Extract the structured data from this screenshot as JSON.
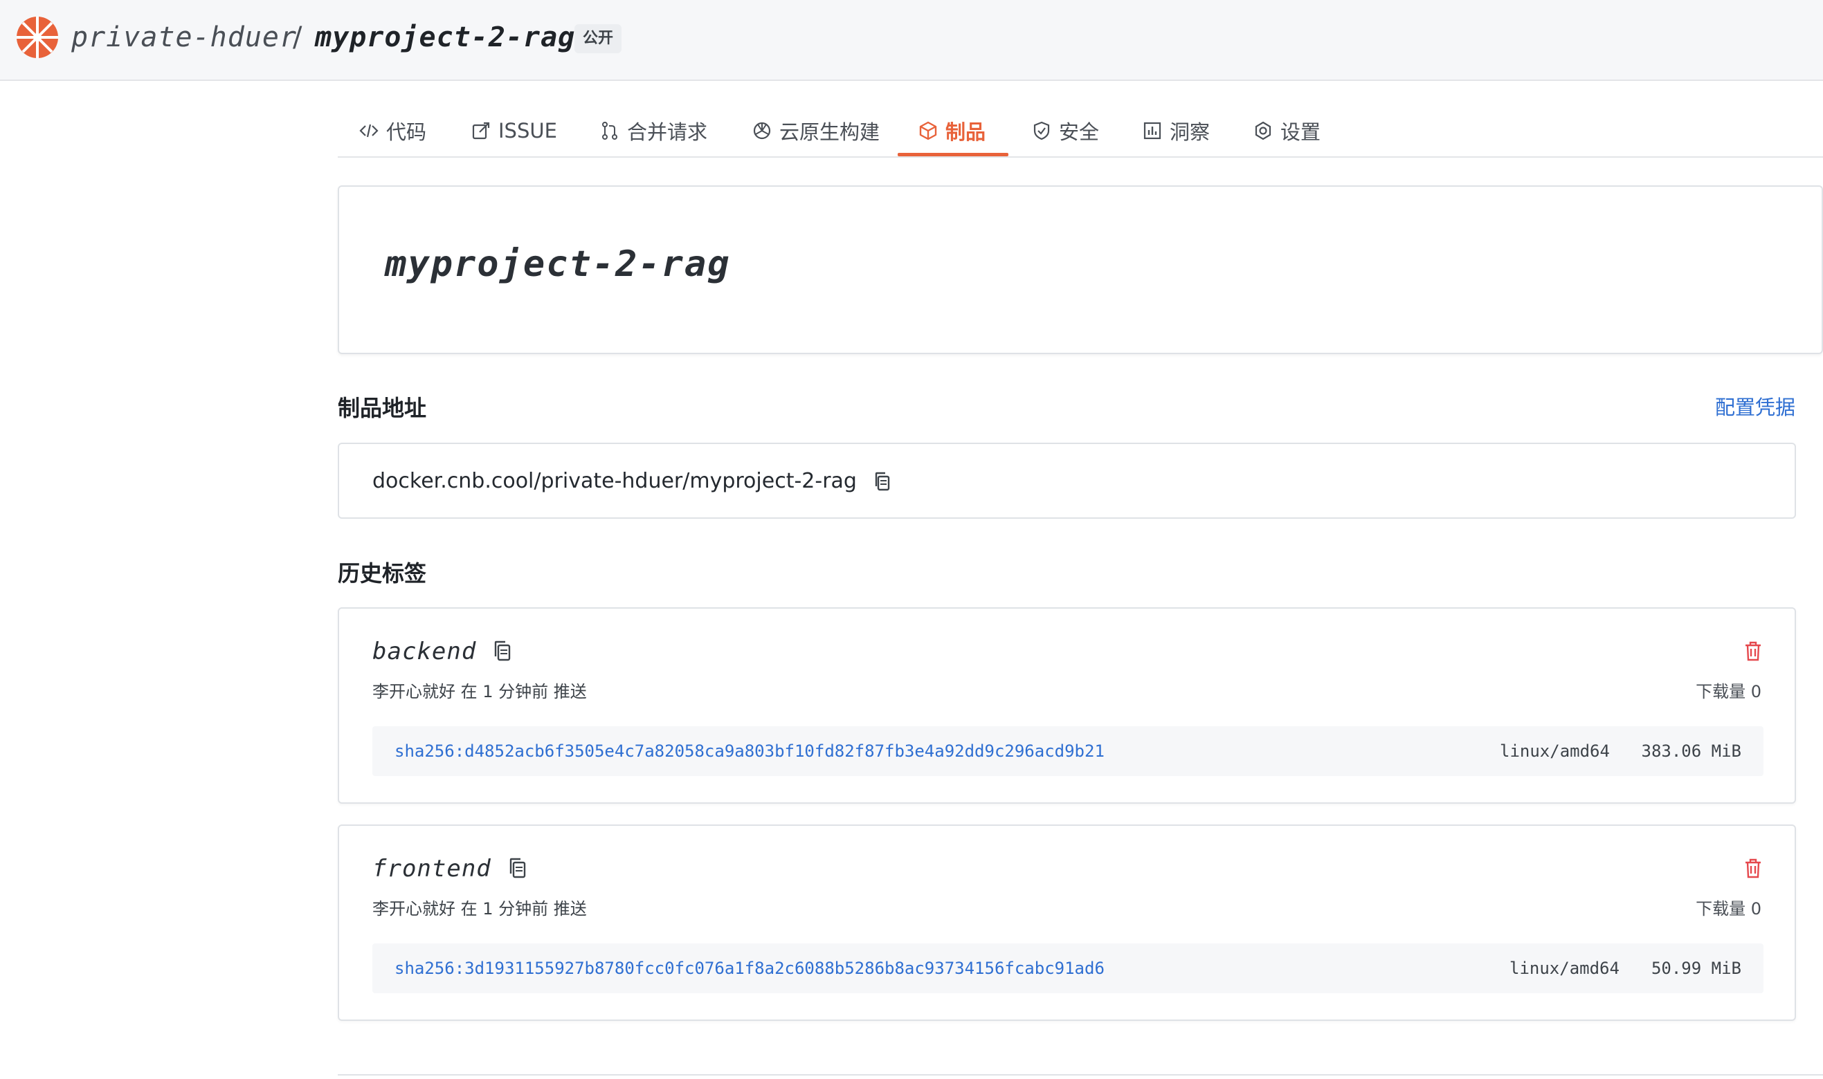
{
  "header": {
    "owner": "private-hduer",
    "separator": "/",
    "repo": "myproject-2-rag",
    "visibility_badge": "公开"
  },
  "tabs": [
    {
      "label": "代码",
      "icon": "code-icon"
    },
    {
      "label": "ISSUE",
      "icon": "issue-icon"
    },
    {
      "label": "合并请求",
      "icon": "merge-request-icon"
    },
    {
      "label": "云原生构建",
      "icon": "build-icon"
    },
    {
      "label": "制品",
      "icon": "package-icon",
      "active": true
    },
    {
      "label": "安全",
      "icon": "shield-icon"
    },
    {
      "label": "洞察",
      "icon": "chart-icon"
    },
    {
      "label": "设置",
      "icon": "settings-icon"
    }
  ],
  "title_card": {
    "title": "myproject-2-rag"
  },
  "artifact_address": {
    "heading": "制品地址",
    "config_link": "配置凭据",
    "address": "docker.cnb.cool/private-hduer/myproject-2-rag"
  },
  "history": {
    "heading": "历史标签",
    "tags": [
      {
        "name": "backend",
        "meta": "李开心就好 在 1 分钟前 推送",
        "downloads": "下载量 0",
        "digest": "sha256:d4852acb6f3505e4c7a82058ca9a803bf10fd82f87fb3e4a92dd9c296acd9b21",
        "platform": "linux/amd64",
        "size": "383.06 MiB"
      },
      {
        "name": "frontend",
        "meta": "李开心就好 在 1 分钟前 推送",
        "downloads": "下载量 0",
        "digest": "sha256:3d1931155927b8780fcc0fc076a1f8a2c6088b5286b8ac93734156fcabc91ad6",
        "platform": "linux/amd64",
        "size": "50.99 MiB"
      }
    ]
  },
  "colors": {
    "accent": "#e8623a",
    "link": "#2f6fd2",
    "danger": "#e5484d"
  }
}
